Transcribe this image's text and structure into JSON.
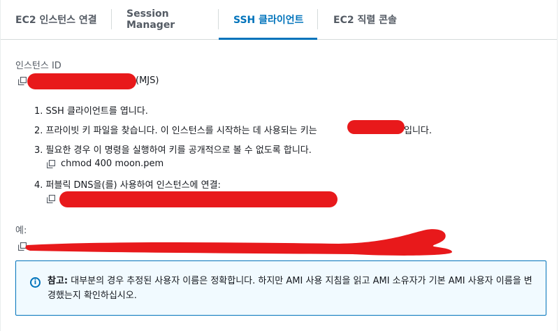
{
  "tabs": [
    {
      "label": "EC2 인스턴스 연결"
    },
    {
      "label": "Session Manager"
    },
    {
      "label": "SSH 클라이언트"
    },
    {
      "label": "EC2 직렬 콘솔"
    }
  ],
  "instance": {
    "label": "인스턴스 ID",
    "suffix": "(MJS)"
  },
  "steps": [
    "1. SSH 클라이언트를 엽니다.",
    "2. 프라이빗 키 파일을 찾습니다. 이 인스턴스를 시작하는 데 사용되는 키는",
    "입니다.",
    "3. 필요한 경우 이 명령을 실행하여 키를 공개적으로 볼 수 없도록 합니다.",
    "chmod 400 moon.pem",
    "4. 퍼블릭 DNS을(를) 사용하여 인스턴스에 연결:"
  ],
  "example": {
    "label": "예:"
  },
  "note": {
    "strong": "참고:",
    "text": " 대부분의 경우 추정된 사용자 이름은 정확합니다. 하지만 AMI 사용 지침을 읽고 AMI 소유자가 기본 AMI 사용자 이름을 변경했는지 확인하십시오."
  },
  "colors": {
    "accent": "#0073bb",
    "redaction": "#e8191b",
    "info_bg": "#f1faff"
  }
}
